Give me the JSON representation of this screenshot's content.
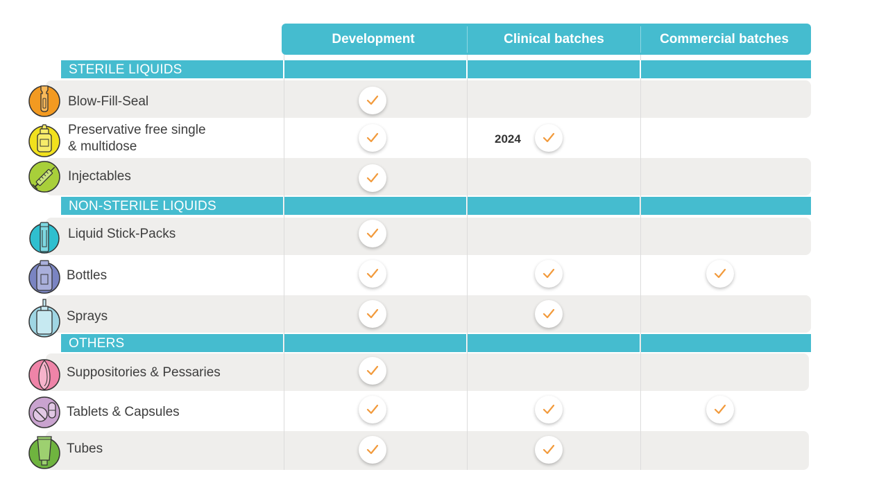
{
  "columns": {
    "development": "Development",
    "clinical": "Clinical batches",
    "commercial": "Commercial batches"
  },
  "sections": {
    "sterile": "STERILE LIQUIDS",
    "non_sterile": "NON-STERILE LIQUIDS",
    "others": "OTHERS"
  },
  "rows": [
    {
      "label": "Blow-Fill-Seal",
      "icon": "vial-icon",
      "color": "#f39a21",
      "development": true,
      "clinical": false,
      "commercial": false
    },
    {
      "label_line1": "Preservative free single",
      "label_line2": "& multidose",
      "icon": "dropper-bottle-icon",
      "color": "#f2e11d",
      "development": true,
      "clinical": true,
      "clinical_note": "2024",
      "commercial": false
    },
    {
      "label": "Injectables",
      "icon": "syringe-icon",
      "color": "#a8cf3a",
      "development": true,
      "clinical": false,
      "commercial": false
    },
    {
      "label": "Liquid Stick-Packs",
      "icon": "stick-pack-icon",
      "color": "#2fbfcf",
      "development": true,
      "clinical": false,
      "commercial": false
    },
    {
      "label": "Bottles",
      "icon": "bottle-icon",
      "color": "#7a84c2",
      "development": true,
      "clinical": true,
      "commercial": true
    },
    {
      "label": "Sprays",
      "icon": "spray-icon",
      "color": "#9fd6e4",
      "development": true,
      "clinical": true,
      "commercial": false
    },
    {
      "label": "Suppositories & Pessaries",
      "icon": "suppository-icon",
      "color": "#ef84a8",
      "development": true,
      "clinical": false,
      "commercial": false
    },
    {
      "label": "Tablets & Capsules",
      "icon": "tablet-capsule-icon",
      "color": "#c9a3cf",
      "development": true,
      "clinical": true,
      "commercial": true
    },
    {
      "label": "Tubes",
      "icon": "tube-icon",
      "color": "#6fb43f",
      "development": true,
      "clinical": true,
      "commercial": false
    }
  ],
  "colors": {
    "accent": "#45bccf",
    "row_shade": "#efeeec",
    "check": "#f29a3b"
  }
}
